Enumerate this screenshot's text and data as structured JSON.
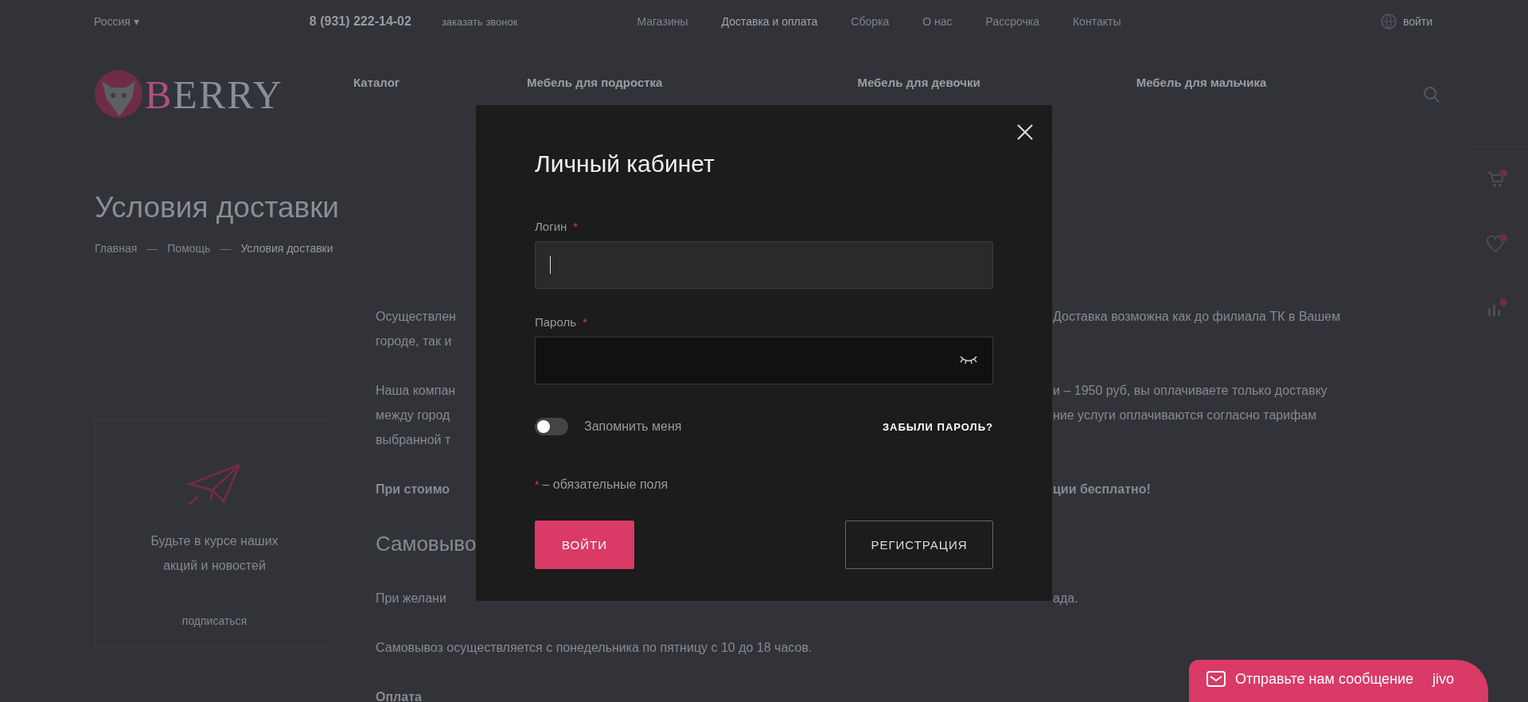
{
  "top_bar": {
    "region": "Россия",
    "region_caret": "▾",
    "phone": "8 (931) 222-14-02",
    "callback": "заказать звонок",
    "links": [
      {
        "label": "Магазины",
        "selected": false
      },
      {
        "label": "Доставка и оплата",
        "selected": true
      },
      {
        "label": "Сборка",
        "selected": false
      },
      {
        "label": "О нас",
        "selected": false
      },
      {
        "label": "Рассрочка",
        "selected": false
      },
      {
        "label": "Контакты",
        "selected": false
      }
    ],
    "login": "войти"
  },
  "header": {
    "logo": "BERRY",
    "nav": [
      "Каталог",
      "Мебель для подростка",
      "Мебель для девочки",
      "Мебель для мальчика"
    ]
  },
  "page": {
    "title": "Условия доставки",
    "breadcrumbs": [
      {
        "kind": "link",
        "text": "Главная"
      },
      {
        "kind": "separator",
        "text": "—"
      },
      {
        "kind": "link",
        "text": "Помощь"
      },
      {
        "kind": "separator",
        "text": "—"
      },
      {
        "kind": "current",
        "text": "Условия доставки"
      }
    ],
    "subscribe": {
      "text": "Будьте в курсе наших акций и новостей",
      "button": "подписаться"
    },
    "content": [
      {
        "kind": "text",
        "left": "Осуществлен",
        "right": "Доставка возможна как до филиала ТК в Вашем"
      },
      {
        "kind": "text",
        "left": "городе, так и"
      },
      {
        "kind": "gap"
      },
      {
        "kind": "text",
        "left": "Наша компан",
        "right": "и – 1950 руб, вы оплачиваете только доставку"
      },
      {
        "kind": "text",
        "left": "между город",
        "right": "ние услуги оплачиваются согласно тарифам"
      },
      {
        "kind": "text",
        "left": "выбранной т"
      },
      {
        "kind": "gap"
      },
      {
        "kind": "bold",
        "left": "При стоимо",
        "right": "ции бесплатно!"
      },
      {
        "kind": "gap"
      },
      {
        "kind": "heading",
        "left": "Самовыво"
      },
      {
        "kind": "gap"
      },
      {
        "kind": "text",
        "left": "При желани",
        "right": "ада."
      },
      {
        "kind": "gap"
      },
      {
        "kind": "text",
        "left": "Самовывоз осуществляется с понедельника по пятницу с 10 до 18 часов."
      },
      {
        "kind": "gap"
      },
      {
        "kind": "bold",
        "left": "Оплата"
      }
    ]
  },
  "side_panel": [
    {
      "kind": "cart"
    },
    {
      "kind": "heart"
    },
    {
      "kind": "compare"
    }
  ],
  "modal": {
    "title": "Личный кабинет",
    "fields": [
      {
        "label": "Логин",
        "required": true,
        "kind": "text",
        "focused": true
      },
      {
        "label": "Пароль",
        "required": true,
        "kind": "password",
        "focused": false
      }
    ],
    "remember": {
      "label": "Запомнить меня",
      "on": false
    },
    "forgot": "ЗАБЫЛИ ПАРОЛЬ?",
    "required_mark": "*",
    "required_note": "– обязательные поля",
    "login_button": "ВОЙТИ",
    "register_button": "РЕГИСТРАЦИЯ"
  },
  "chat": {
    "text": "Отправьте нам сообщение",
    "brand": "jivo"
  }
}
